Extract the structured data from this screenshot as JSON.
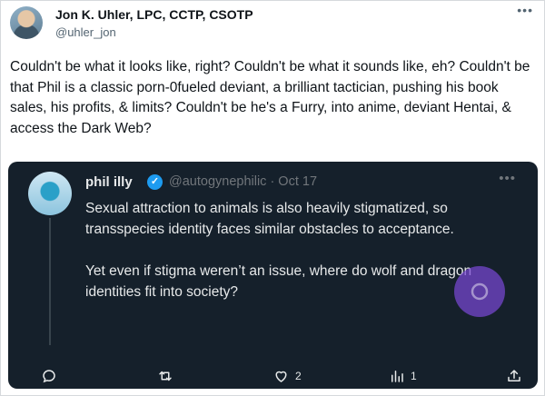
{
  "author": {
    "name": "Jon K. Uhler, LPC, CCTP, CSOTP",
    "handle": "@uhler_jon"
  },
  "tweet": {
    "text": "Couldn't be what it looks like, right? Couldn't be what it sounds like, eh? Couldn't be that Phil is a classic porn-0fueled deviant, a brilliant tactician, pushing his book sales, his profits, & limits? Couldn't be he's a Furry, into anime, deviant Hentai, & access the Dark Web?"
  },
  "quoted": {
    "name": "phil illy",
    "handle_date": "@autogynephilic · Oct 17",
    "paragraph1": "Sexual attraction to animals is also heavily stigmatized, so transspecies identity faces similar obstacles to acceptance.",
    "paragraph2": "Yet even if stigma weren’t an issue, where do wolf and dragon identities fit into society?"
  },
  "actions": {
    "likes": "2",
    "views": "1"
  },
  "icons": {
    "verified": "verified-badge-icon",
    "reply": "reply-icon",
    "retweet": "retweet-icon",
    "like": "heart-icon",
    "views": "views-chart-icon",
    "share": "share-icon",
    "more": "more-icon"
  },
  "colors": {
    "card_bg": "#15202b",
    "verified": "#1d9bf0",
    "play_overlay": "#7846d2"
  }
}
